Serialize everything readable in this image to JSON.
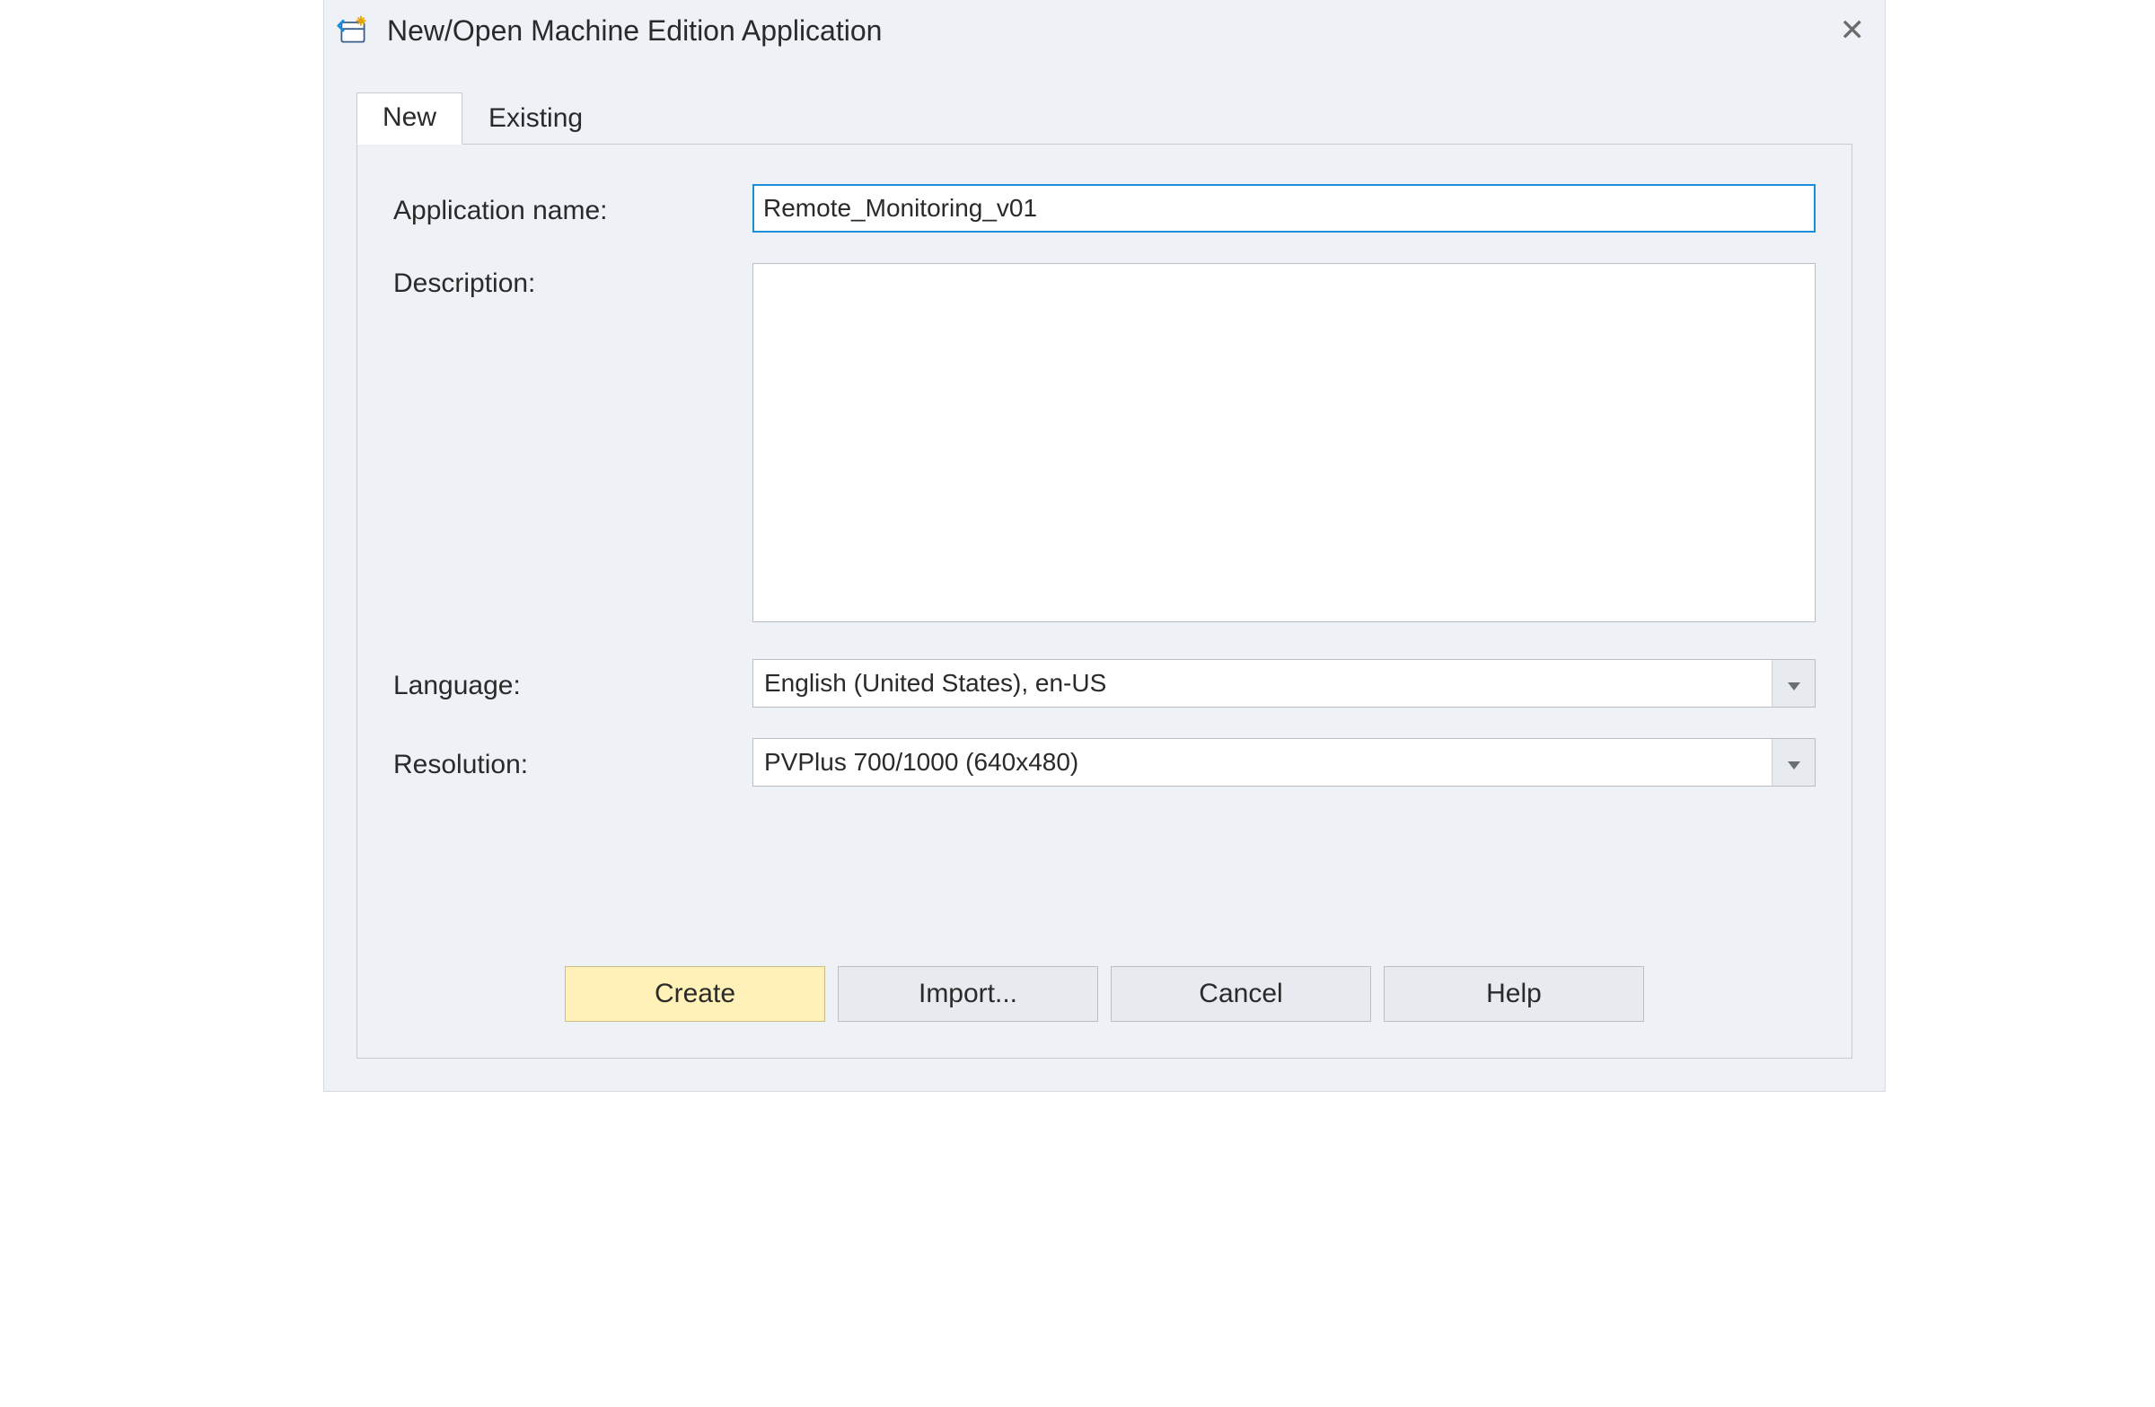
{
  "title": "New/Open Machine Edition Application",
  "tabs": {
    "new": "New",
    "existing": "Existing",
    "active": "new"
  },
  "labels": {
    "application_name": "Application name:",
    "description": "Description:",
    "language": "Language:",
    "resolution": "Resolution:"
  },
  "fields": {
    "application_name": "Remote_Monitoring_v01",
    "description": "",
    "language": "English (United States), en-US",
    "resolution": "PVPlus 700/1000 (640x480)"
  },
  "buttons": {
    "create": "Create",
    "import": "Import...",
    "cancel": "Cancel",
    "help": "Help"
  }
}
